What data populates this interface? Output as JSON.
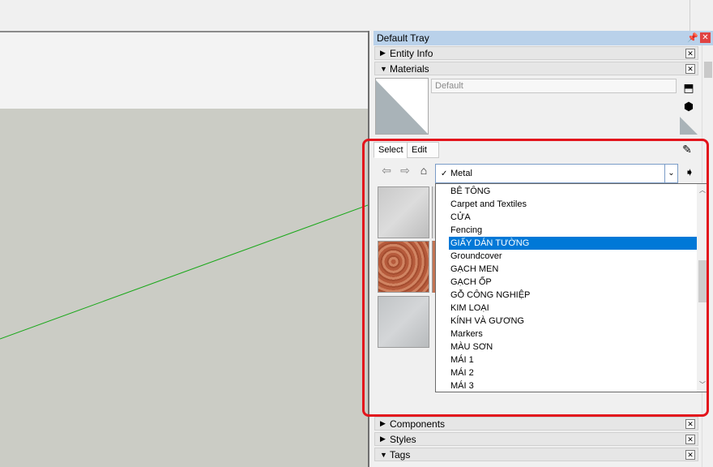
{
  "tray": {
    "title": "Default Tray",
    "pin_icon": "pin-icon",
    "close_icon": "close-icon"
  },
  "panels": {
    "entity_info": "Entity Info",
    "materials": "Materials",
    "components": "Components",
    "styles": "Styles",
    "tags": "Tags"
  },
  "materials": {
    "name_value": "Default",
    "tabs": {
      "select": "Select",
      "edit": "Edit"
    },
    "collection_selected": "Metal",
    "collections": [
      "BÊ TÔNG",
      "Carpet and Textiles",
      "CỬA",
      "Fencing",
      "GIẤY DÁN TƯỜNG",
      "Groundcover",
      "GẠCH MEN",
      "GẠCH ỐP",
      "GỖ CÔNG NGHIỆP",
      "KIM LOẠI",
      "KÍNH VÀ GƯƠNG",
      "Markers",
      "MÀU SƠN",
      "MÁI 1",
      "MÁI 2",
      "MÁI 3"
    ],
    "highlighted_index": 4
  },
  "colors": {
    "highlight": "#0078d7",
    "annotation": "#e3141c",
    "tray_title": "#b9d1ea",
    "axis_green": "#1aa81a"
  }
}
